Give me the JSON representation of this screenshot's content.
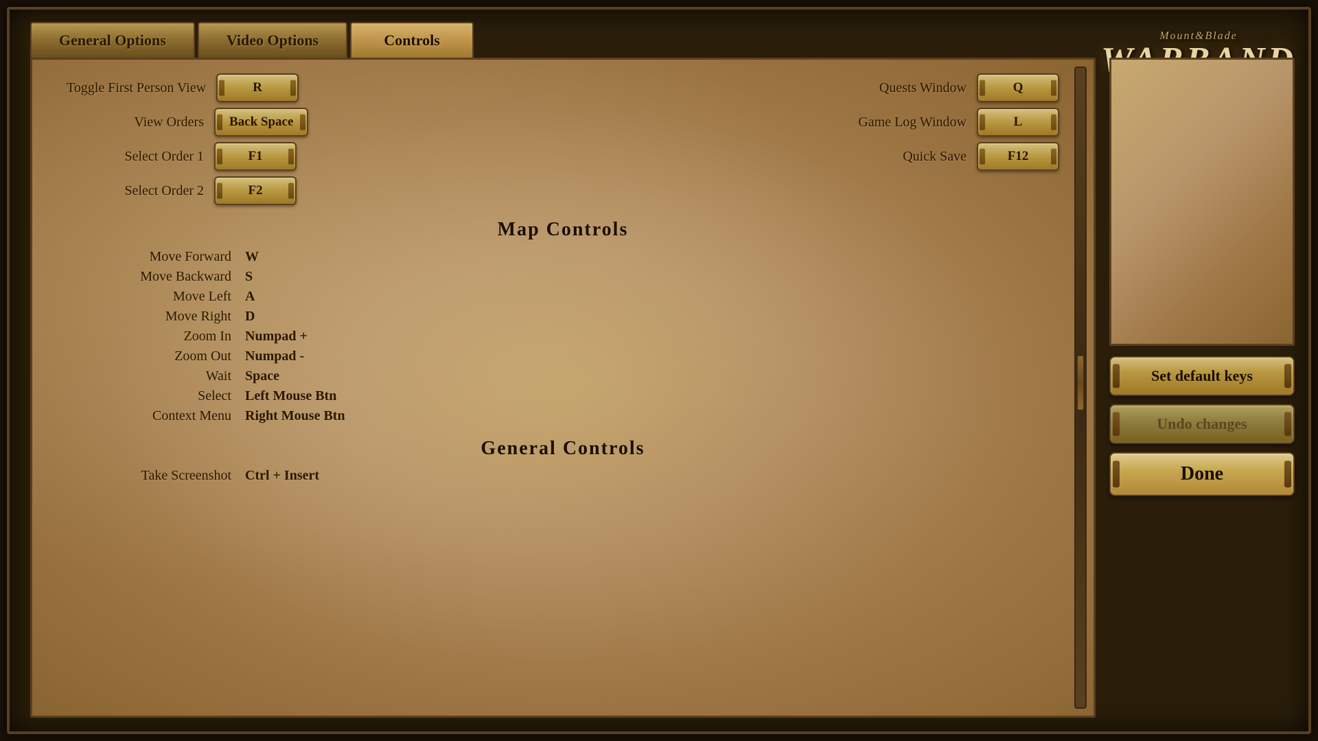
{
  "logo": {
    "top_text": "Mount&Blade",
    "bottom_text": "WARBAND"
  },
  "tabs": [
    {
      "label": "General Options",
      "active": false
    },
    {
      "label": "Video Options",
      "active": false
    },
    {
      "label": "Controls",
      "active": true
    }
  ],
  "left_controls": [
    {
      "action": "Toggle First Person View",
      "key": "R"
    },
    {
      "action": "View Orders",
      "key": "Back Space"
    },
    {
      "action": "Select Order 1",
      "key": "F1"
    },
    {
      "action": "Select Order 2",
      "key": "F2"
    }
  ],
  "right_controls": [
    {
      "action": "Quests Window",
      "key": "Q"
    },
    {
      "action": "Game Log Window",
      "key": "L"
    },
    {
      "action": "Quick Save",
      "key": "F12"
    }
  ],
  "map_controls_header": "Map Controls",
  "map_controls": [
    {
      "action": "Move Forward",
      "key": "W"
    },
    {
      "action": "Move Backward",
      "key": "S"
    },
    {
      "action": "Move Left",
      "key": "A"
    },
    {
      "action": "Move Right",
      "key": "D"
    },
    {
      "action": "Zoom In",
      "key": "Numpad +"
    },
    {
      "action": "Zoom Out",
      "key": "Numpad -"
    },
    {
      "action": "Wait",
      "key": "Space"
    },
    {
      "action": "Select",
      "key": "Left Mouse Btn"
    },
    {
      "action": "Context Menu",
      "key": "Right Mouse Btn"
    }
  ],
  "general_controls_header": "General Controls",
  "general_controls": [
    {
      "action": "Take Screenshot",
      "key": "Ctrl + Insert"
    }
  ],
  "buttons": {
    "set_default_keys": "Set default keys",
    "undo_changes": "Undo changes",
    "done": "Done"
  }
}
